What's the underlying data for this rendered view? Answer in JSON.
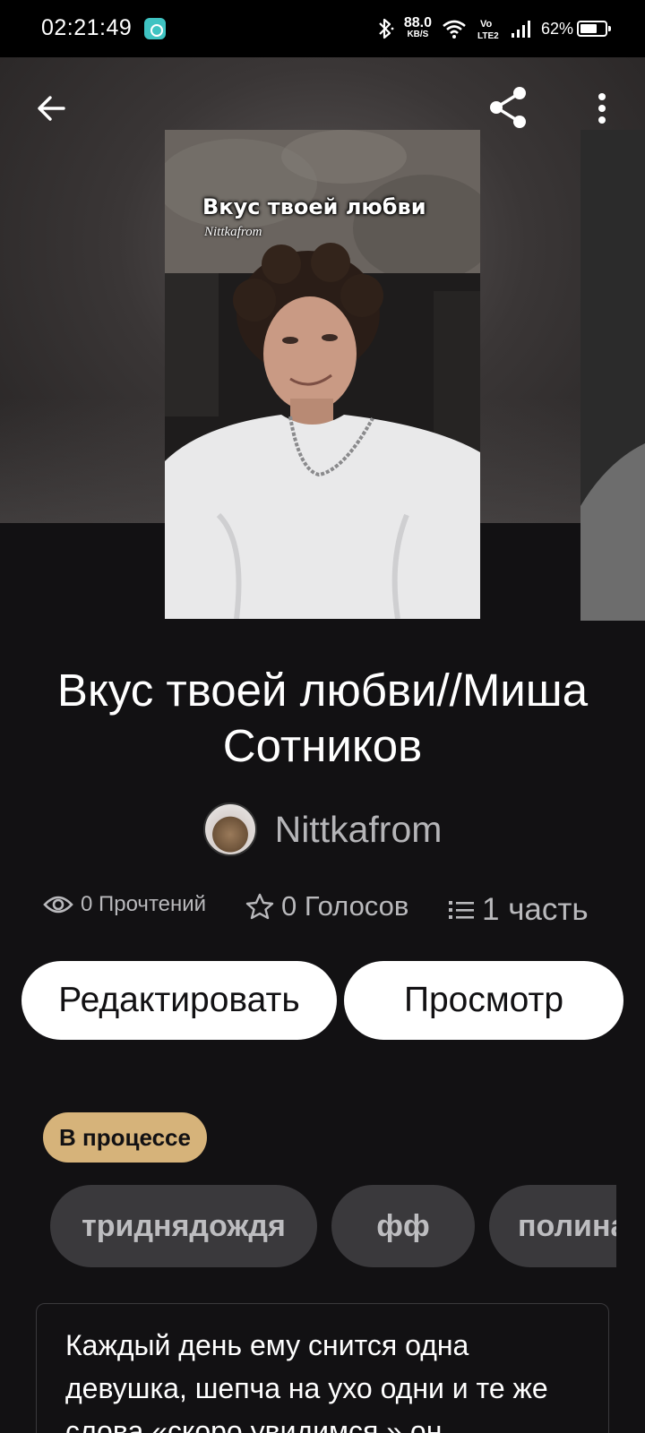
{
  "status_bar": {
    "time": "02:21:49",
    "speed_value": "88.0",
    "speed_unit": "KB/S",
    "network": "Vo LTE2",
    "battery": "62%"
  },
  "header": {
    "back_icon": "arrow-left-icon",
    "share_icon": "share-icon",
    "menu_icon": "more-vertical-icon"
  },
  "cover": {
    "title": "Вкус твоей любви",
    "author": "Nittkafrom"
  },
  "book": {
    "title": "Вкус твоей любви//Миша Сотников",
    "author": "Nittkafrom"
  },
  "stats": {
    "reads": "0 Прочтений",
    "votes": "0 Голосов",
    "parts": "1 часть"
  },
  "actions": {
    "edit": "Редактировать",
    "view": "Просмотр"
  },
  "status": "В процессе",
  "tags": [
    "триднядождя",
    "фф",
    "полина"
  ],
  "description": "Каждый день ему снится одна девушка, шепча на ухо одни и те же слова «скоро увидимся ».он",
  "colors": {
    "background": "#121113",
    "badge": "#d6b37a",
    "tag_bg": "#3a393c",
    "button_bg": "#ffffff"
  }
}
